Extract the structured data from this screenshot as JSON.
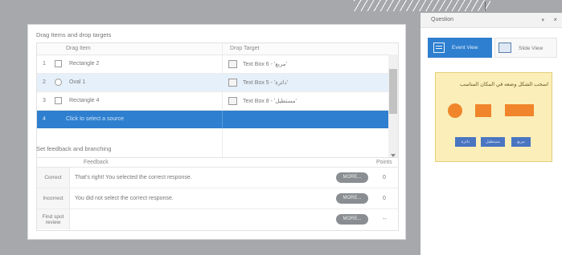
{
  "drag_drop": {
    "section_title": "Drag Items and drop targets",
    "col_item": "Drag Item",
    "col_target": "Drop Target",
    "rows": [
      {
        "num": "1",
        "item": "Rectangle 2",
        "target": "Text Box 6 - 'مربع'"
      },
      {
        "num": "2",
        "item": "Oval 1",
        "target": "Text Box 5 - 'دائرة'"
      },
      {
        "num": "3",
        "item": "Rectangle 4",
        "target": "Text Box 8 - 'مستطيل'"
      },
      {
        "num": "4",
        "item": "Click to select a source"
      }
    ]
  },
  "feedback": {
    "section_title": "Set feedback and branching",
    "col_feedback": "Feedback",
    "col_points": "Points",
    "rows": [
      {
        "label": "Correct",
        "text": "That's right!  You selected the correct response.",
        "more": "MORE...",
        "points": "0"
      },
      {
        "label": "Incorrect",
        "text": "You did not select the correct response.",
        "more": "MORE...",
        "points": "0"
      },
      {
        "label": "Find spot review",
        "text": "",
        "more": "MORE...",
        "points": "--"
      }
    ]
  },
  "question_pane": {
    "title": "Question",
    "pin": "▾",
    "close": "×",
    "event_view": "Event View",
    "slide_view": "Slide View",
    "preview_title": "اسحب الشكل وضعه في المكان المناسب",
    "preview_boxes": [
      "دائرة",
      "مستطيل",
      "مربع"
    ]
  }
}
